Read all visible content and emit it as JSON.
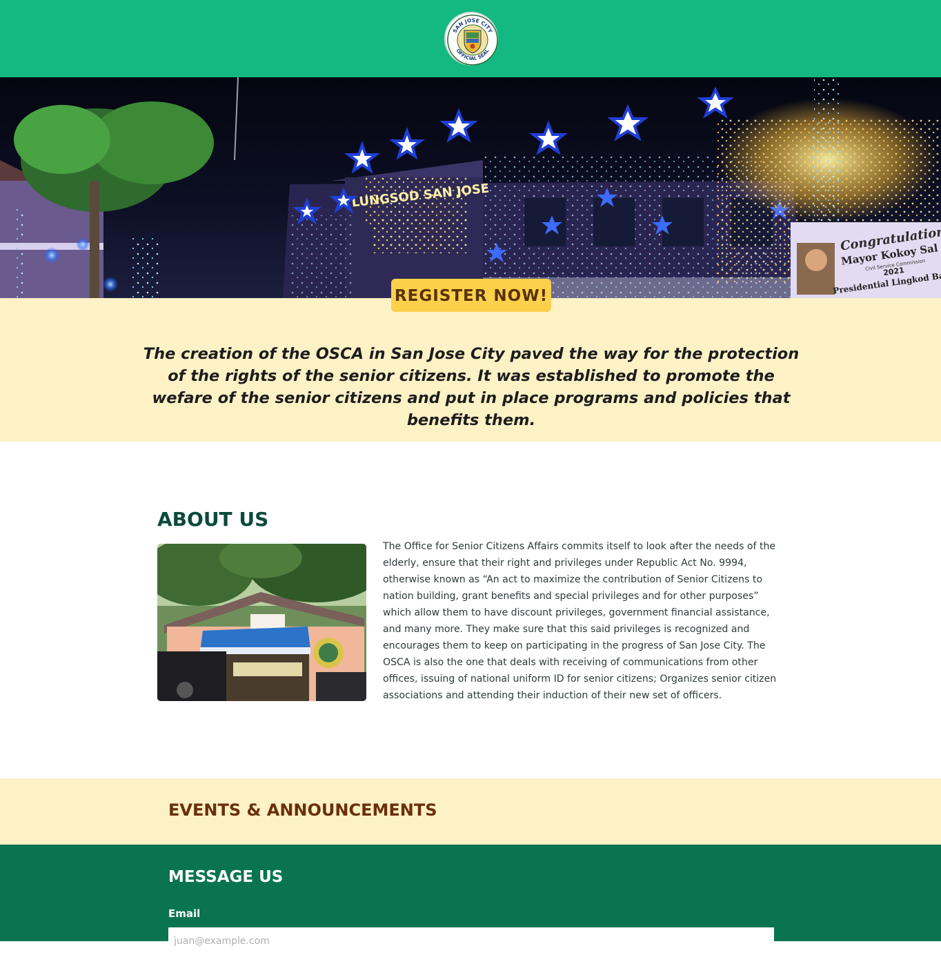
{
  "header": {
    "seal_top_text": "SAN JOSE CITY",
    "seal_bottom_text": "OFFICIAL SEAL",
    "brand_color": "#13b981"
  },
  "hero": {
    "building_sign": "LUNGSOD SAN JOSE",
    "banner_line1": "Congratulation",
    "banner_line2": "Mayor Kokoy Sal",
    "banner_line3": "Civil Service Commission",
    "banner_line4": "2021",
    "banner_line5": "Presidential Lingkod Bay"
  },
  "register": {
    "label": "REGISTER NOW!"
  },
  "mission": {
    "text": "The creation of the OSCA in San Jose City paved the way for the protection of the rights of the senior citizens. It was established to promote the wefare of the senior citizens and put in place programs and policies that benefits them."
  },
  "about": {
    "title": "ABOUT US",
    "body": "The Office for Senior Citizens Affairs commits itself to look after the needs of the elderly, ensure that their right and privileges under Republic Act No. 9994, otherwise known as “An act to maximize the contribution of Senior Citizens to nation building, grant benefits and special privileges and for other purposes” which allow them to have discount privileges, government financial assistance, and many more. They make sure that this said privileges is recognized and encourages them to keep on participating in the progress of San Jose City. The OSCA is also the one that deals with receiving of communications from other offices, issuing of national uniform ID for senior citizens; Organizes senior citizen associations and attending their induction of their new set of officers."
  },
  "events": {
    "title": "EVENTS & ANNOUNCEMENTS"
  },
  "message": {
    "title": "MESSAGE US",
    "email_label": "Email",
    "email_placeholder": "juan@example.com",
    "email_value": ""
  }
}
